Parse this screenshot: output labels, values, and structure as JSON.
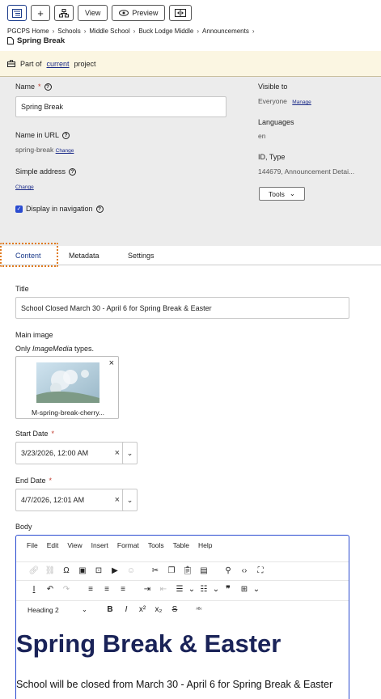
{
  "toolbar": {
    "view_label": "View",
    "preview_label": "Preview"
  },
  "breadcrumb": [
    "PGCPS Home",
    "Schools",
    "Middle School",
    "Buck Lodge Middle",
    "Announcements"
  ],
  "page_name": "Spring Break",
  "project": {
    "prefix": "Part of",
    "link": "current",
    "suffix": "project"
  },
  "properties": {
    "name_label": "Name",
    "name_value": "Spring Break",
    "url_label": "Name in URL",
    "url_value": "spring-break",
    "url_change": "Change",
    "simple_address_label": "Simple address",
    "simple_address_change": "Change",
    "display_nav_label": "Display in navigation",
    "visible_to_label": "Visible to",
    "visible_to_value": "Everyone",
    "visible_to_manage": "Manage",
    "languages_label": "Languages",
    "languages_value": "en",
    "id_type_label": "ID, Type",
    "id_type_value": "144679, Announcement Detai...",
    "tools_label": "Tools"
  },
  "tabs": [
    "Content",
    "Metadata",
    "Settings"
  ],
  "content": {
    "title_label": "Title",
    "title_value": "School Closed March 30 - April 6 for Spring Break & Easter",
    "main_image_label": "Main image",
    "main_image_hint_prefix": "Only ",
    "main_image_hint_em": "ImageMedia",
    "main_image_hint_suffix": " types.",
    "image_caption": "M-spring-break-cherry...",
    "start_label": "Start Date",
    "start_value": "3/23/2026, 12:00 AM",
    "end_label": "End Date",
    "end_value": "4/7/2026, 12:01 AM",
    "body_label": "Body"
  },
  "editor": {
    "menus": [
      "File",
      "Edit",
      "View",
      "Insert",
      "Format",
      "Tools",
      "Table",
      "Help"
    ],
    "format_select": "Heading 2",
    "heading": "Spring Break & Easter",
    "paragraph": "School will be closed from March 30 - April 6 for Spring Break & Easter"
  },
  "colors": {
    "accent": "#2a4bd0",
    "focus_outline": "#e07b20",
    "project_bar": "#fbf6e2",
    "heading": "#1a2358"
  }
}
